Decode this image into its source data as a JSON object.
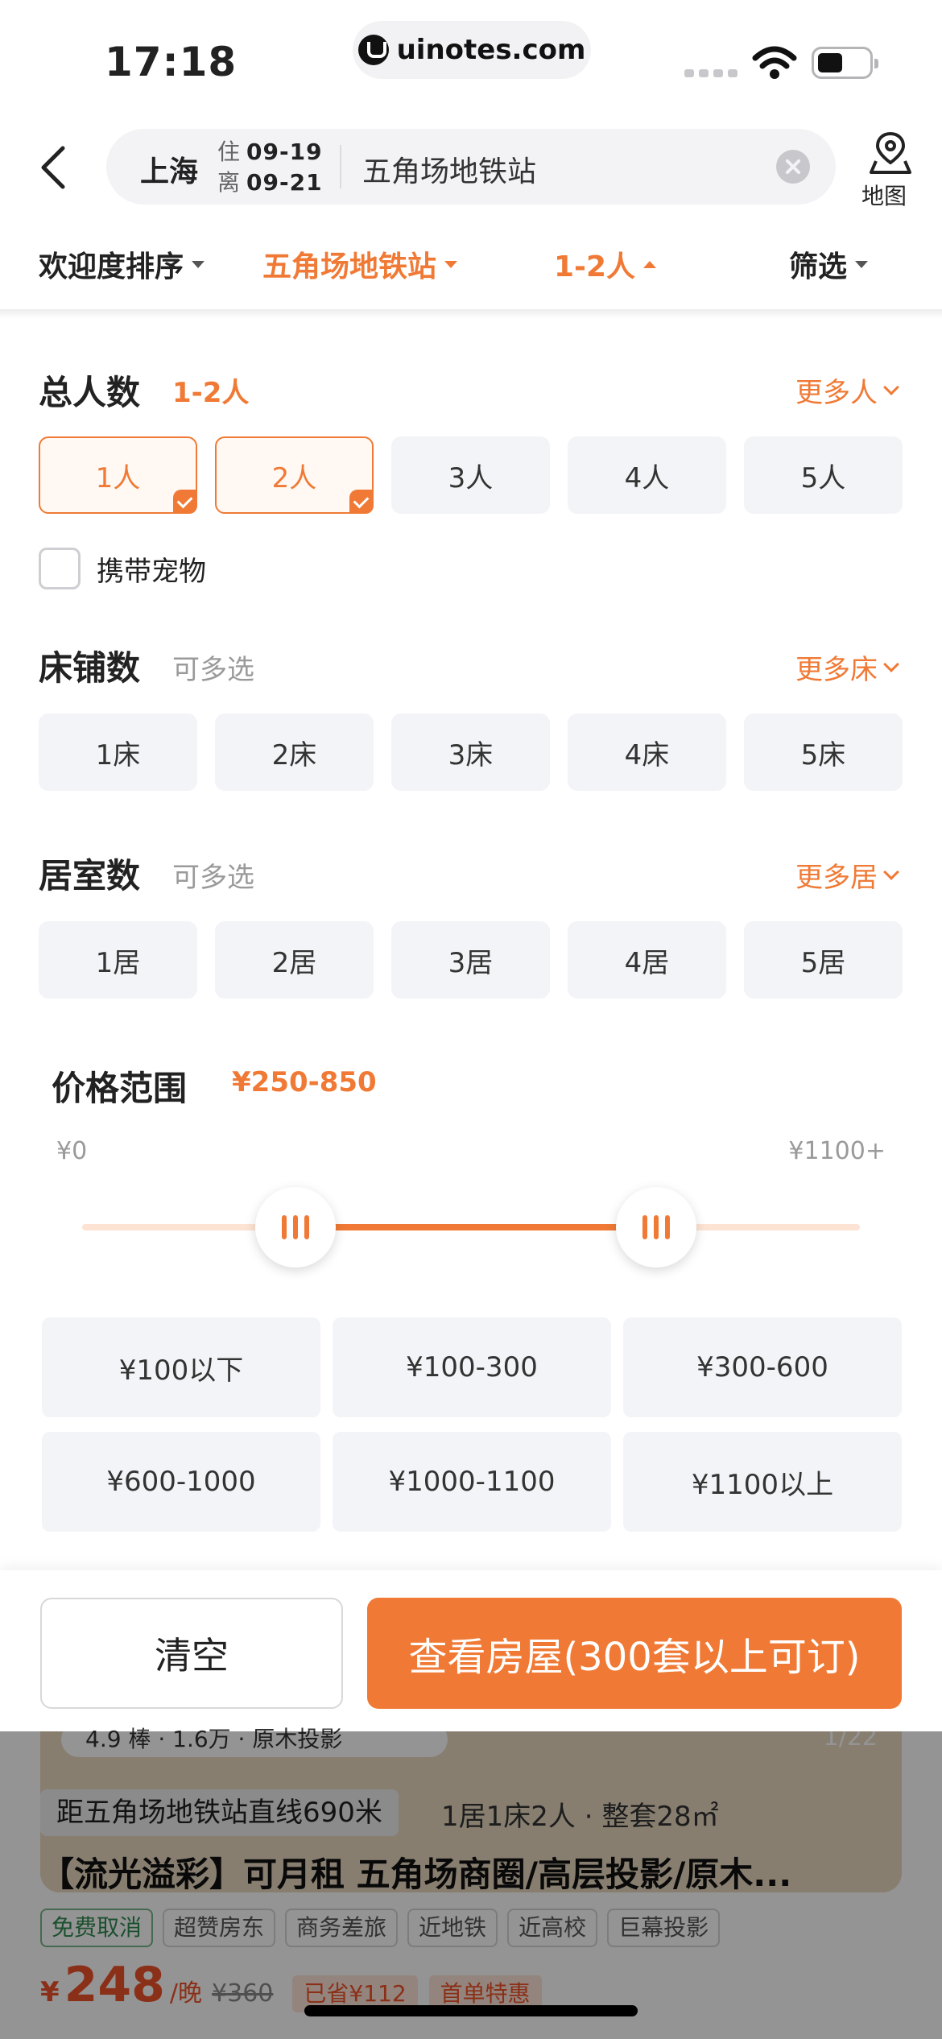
{
  "status": {
    "time": "17:18",
    "url": "uinotes.com"
  },
  "search": {
    "city": "上海",
    "checkin_label": "住",
    "checkin_date": "09-19",
    "checkout_label": "离",
    "checkout_date": "09-21",
    "keyword": "五角场地铁站",
    "map_label": "地图"
  },
  "sortbar": {
    "sort": "欢迎度排序",
    "location": "五角场地铁站",
    "guests": "1-2人",
    "filter": "筛选"
  },
  "guests": {
    "title": "总人数",
    "value": "1-2人",
    "more": "更多人",
    "options": [
      "1人",
      "2人",
      "3人",
      "4人",
      "5人"
    ],
    "selected": [
      "1人",
      "2人"
    ],
    "pet_label": "携带宠物"
  },
  "beds": {
    "title": "床铺数",
    "hint": "可多选",
    "more": "更多床",
    "options": [
      "1床",
      "2床",
      "3床",
      "4床",
      "5床"
    ]
  },
  "rooms": {
    "title": "居室数",
    "hint": "可多选",
    "more": "更多居",
    "options": [
      "1居",
      "2居",
      "3居",
      "4居",
      "5居"
    ]
  },
  "price": {
    "title": "价格范围",
    "value": "¥250-850",
    "min_label": "¥0",
    "max_label": "¥1100+",
    "range_min": 0,
    "range_max": 1100,
    "selected_low": 250,
    "selected_high": 850,
    "presets": [
      "¥100以下",
      "¥100-300",
      "¥300-600",
      "¥600-1000",
      "¥1000-1100",
      "¥1100以上"
    ]
  },
  "actions": {
    "clear": "清空",
    "view": "查看房屋(300套以上可订)"
  },
  "listing": {
    "rating": "4.9 棒 · 1.6万 · 原木投影",
    "image_counter": "1/22",
    "distance": "距五角场地铁站直线690米",
    "specs": "1居1床2人 · 整套28㎡",
    "title": "【流光溢彩】可月租 五角场商圈/高层投影/原木...",
    "tags": [
      "免费取消",
      "超赞房东",
      "商务差旅",
      "近地铁",
      "近高校",
      "巨幕投影"
    ],
    "currency": "¥",
    "price": "248",
    "unit": "/晚",
    "old_price": "¥360",
    "saved": "已省¥112",
    "promo": "首单特惠"
  },
  "colors": {
    "accent": "#f07a35",
    "price_red": "#f0532a",
    "chip_bg": "#f3f4f7"
  }
}
